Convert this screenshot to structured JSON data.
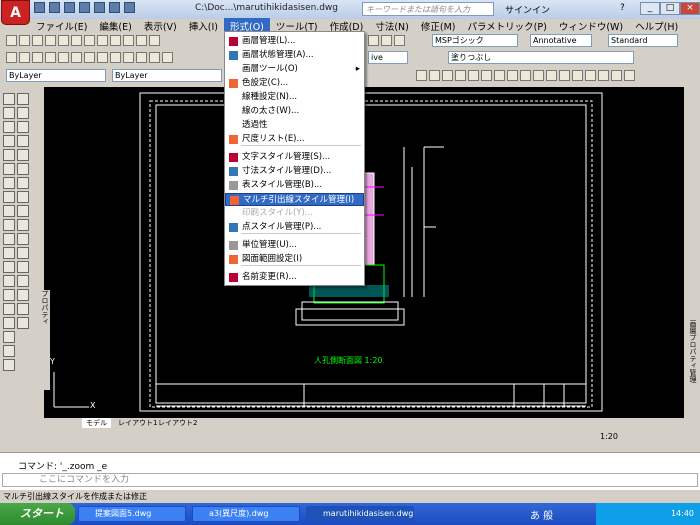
{
  "titlebar": {
    "title": "C:\\Doc...\\marutihikidasisen.dwg",
    "search_placeholder": "キーワードまたは語句を入力",
    "signin": "サインイン",
    "help_icon": "?"
  },
  "menubar": [
    "ファイル(E)",
    "編集(E)",
    "表示(V)",
    "挿入(I)",
    "形式(O)",
    "ツール(T)",
    "作成(D)",
    "寸法(N)",
    "修正(M)",
    "パラメトリック(P)",
    "ウィンドウ(W)",
    "ヘルプ(H)"
  ],
  "toolbar": {
    "textstyle": "MSPゴシック",
    "annotative": "Annotative",
    "tablestyle": "Standard",
    "layer": "ByLayer",
    "linetype": "ByLayer",
    "fill": "塗りつぶし",
    "dimstyle": "ive"
  },
  "format_menu": [
    {
      "label": "画層管理(L)...",
      "icon": "layer-icon"
    },
    {
      "label": "画層状態管理(A)...",
      "icon": "layer-state-icon"
    },
    {
      "label": "画層ツール(O)",
      "icon": "",
      "submenu": true
    },
    {
      "label": "色設定(C)...",
      "icon": "color-icon"
    },
    {
      "label": "線種設定(N)...",
      "icon": ""
    },
    {
      "label": "線の太さ(W)...",
      "icon": ""
    },
    {
      "label": "透過性",
      "icon": ""
    },
    {
      "label": "尺度リスト(E)...",
      "icon": "scale-list-icon"
    },
    {
      "label": "文字スタイル管理(S)...",
      "icon": "text-style-icon"
    },
    {
      "label": "寸法スタイル管理(D)...",
      "icon": "dim-style-icon"
    },
    {
      "label": "表スタイル管理(B)...",
      "icon": "table-style-icon"
    },
    {
      "label": "マルチ引出線スタイル管理(I)",
      "icon": "mleader-icon",
      "highlighted": true
    },
    {
      "label": "印刷スタイル(Y)...",
      "icon": "",
      "disabled": true
    },
    {
      "label": "点スタイル管理(P)...",
      "icon": "point-style-icon"
    },
    {
      "label": "単位管理(U)...",
      "icon": "units-icon"
    },
    {
      "label": "図面範囲設定(I)",
      "icon": "limits-icon"
    },
    {
      "label": "名前変更(R)...",
      "icon": "rename-icon"
    }
  ],
  "drawing": {
    "caption": "人孔側断面図 1:20"
  },
  "layout_tabs": [
    "モデル",
    "レイアウト1",
    "レイアウト2"
  ],
  "side_panels": {
    "left": "プロパティ",
    "right": "画層プロパティ管理"
  },
  "annotation_scale": "1:20",
  "command": {
    "history": "コマンド: '_.zoom _e",
    "prompt": "ここにコマンドを入力"
  },
  "status": "マルチ引出線スタイルを作成または修正",
  "taskbar": {
    "start": "スタート",
    "tasks": [
      "提案図面5.dwg",
      "a3(異尺度).dwg",
      "marutihikidasisen.dwg"
    ],
    "ime": "あ 般",
    "time": "14:40"
  }
}
